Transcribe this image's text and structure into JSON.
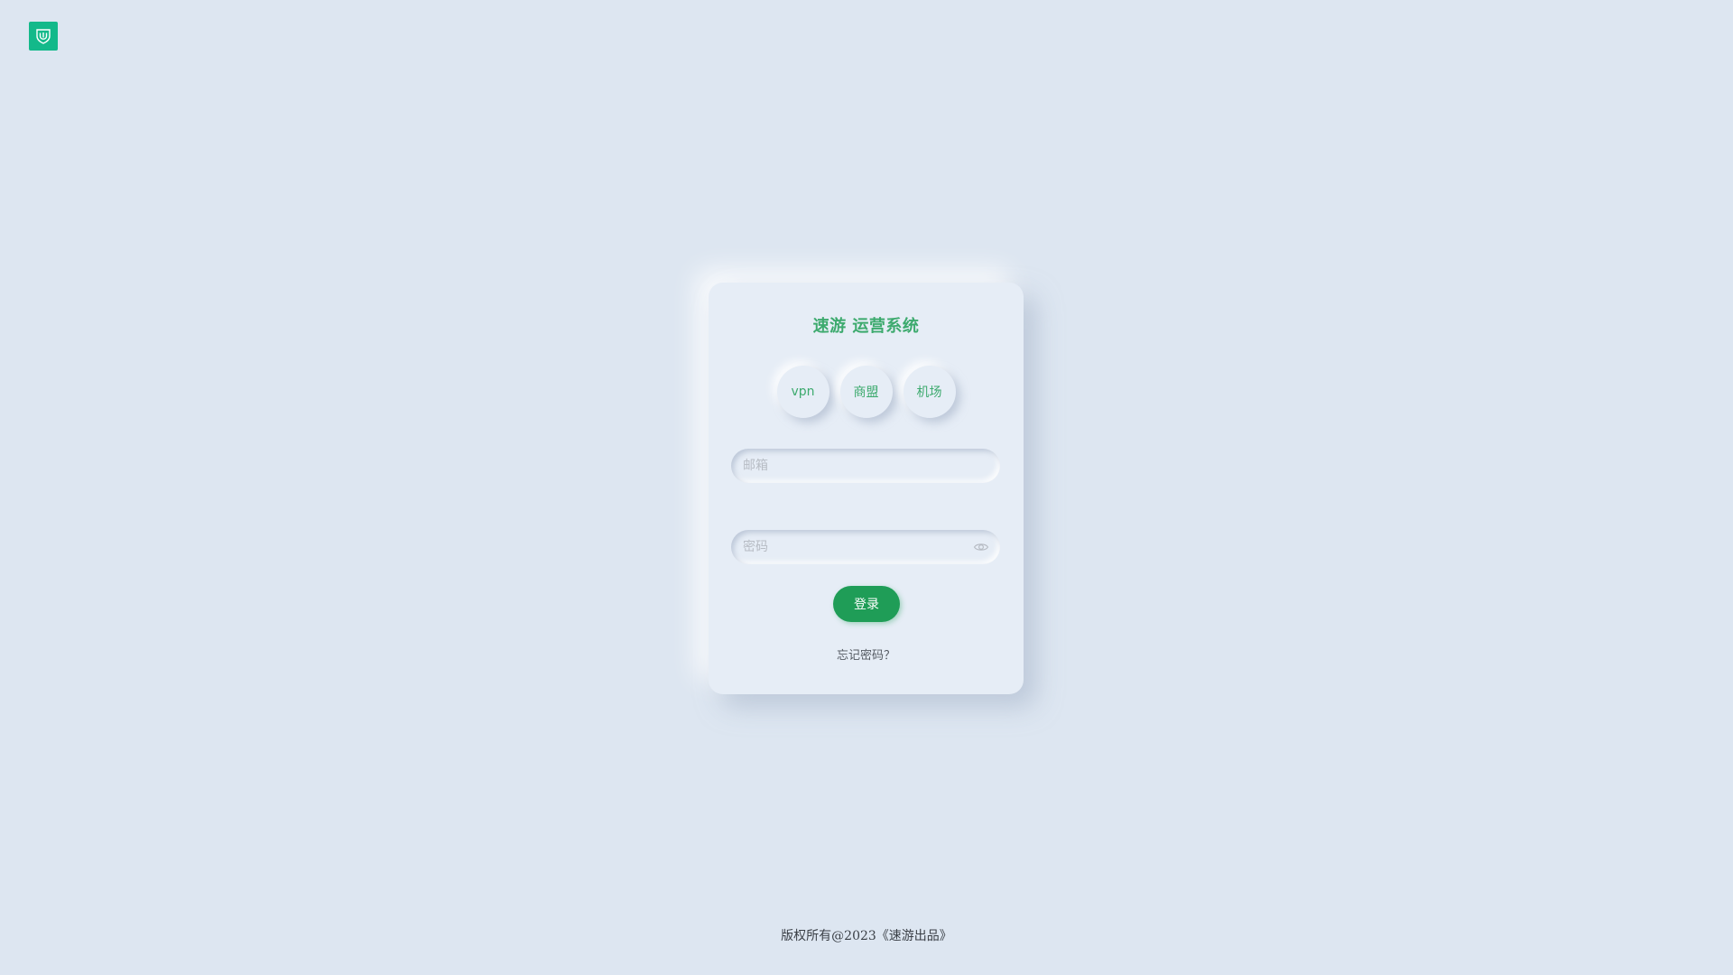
{
  "logo": {
    "icon": "brand-shield-icon",
    "color": "#13b98a"
  },
  "login_card": {
    "title": "速游 运营系统",
    "title_color": "#3daa6e",
    "tabs": [
      {
        "label": "vpn"
      },
      {
        "label": "商盟"
      },
      {
        "label": "机场"
      }
    ],
    "email": {
      "value": "",
      "placeholder": "邮箱"
    },
    "password": {
      "value": "",
      "placeholder": "密码",
      "toggle_icon": "eye-icon"
    },
    "login_label": "登录",
    "login_color": "#1f9d57",
    "forgot_label": "忘记密码？"
  },
  "footer": {
    "copyright": "版权所有@2023《速游出品》"
  }
}
